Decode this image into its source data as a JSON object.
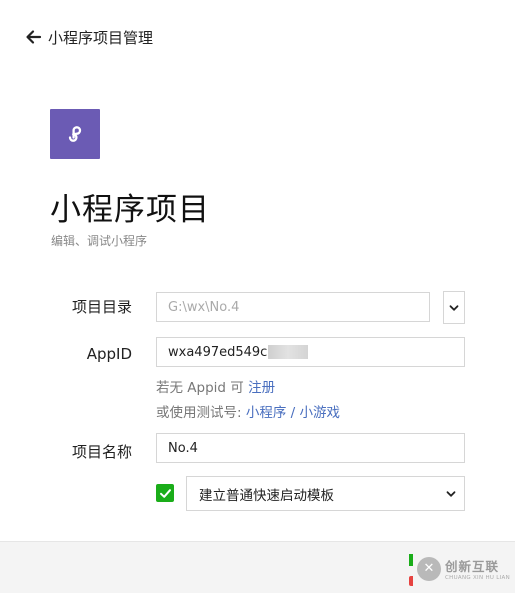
{
  "header": {
    "back_icon": "arrow-left-icon",
    "title": "小程序项目管理"
  },
  "logo": {
    "icon": "miniprogram-link-icon",
    "bg_color": "#6b5bb4"
  },
  "page": {
    "title": "小程序项目",
    "subtitle": "编辑、调试小程序"
  },
  "form": {
    "directory": {
      "label": "项目目录",
      "placeholder": "G:\\wx\\No.4"
    },
    "appid": {
      "label": "AppID",
      "value": "wxa497ed549c"
    },
    "hint_register": {
      "text": "若无 Appid 可 ",
      "link": "注册"
    },
    "hint_test": {
      "text": "或使用测试号: ",
      "link_miniprogram": "小程序",
      "separator": " / ",
      "link_minigame": "小游戏"
    },
    "project_name": {
      "label": "项目名称",
      "value": "No.4"
    },
    "template": {
      "checked": true,
      "selected": "建立普通快速启动模板"
    }
  },
  "watermark": {
    "logo_glyph": "✕",
    "text_cn": "创新互联",
    "text_en": "CHUANG XIN HU LIAN"
  },
  "colors": {
    "accent_green": "#1aad19",
    "link_blue": "#4a6fbf",
    "danger_red": "#e64340"
  }
}
